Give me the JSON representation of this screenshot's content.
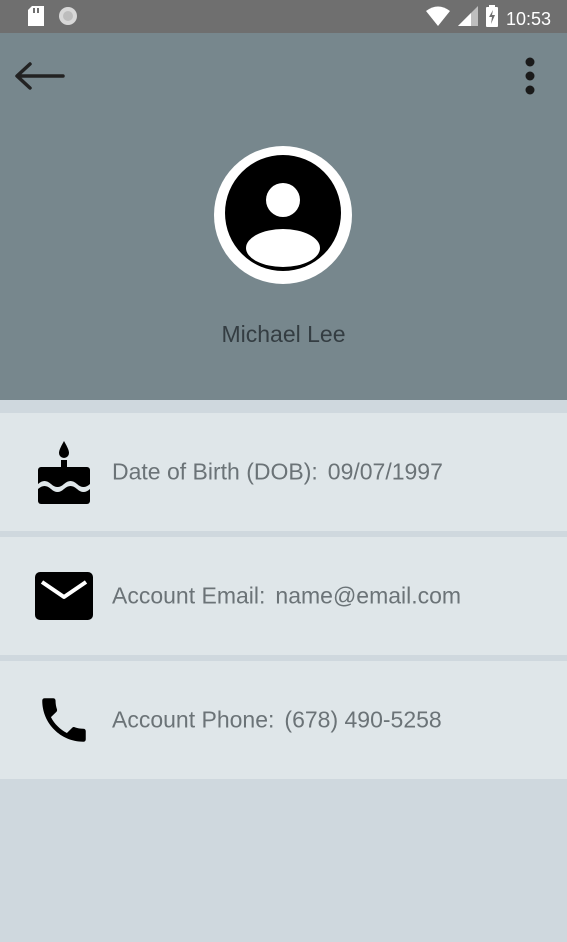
{
  "status_bar": {
    "time": "10:53",
    "icons": [
      "sd-card-icon",
      "circle-indicator-icon",
      "wifi-icon",
      "signal-icon",
      "battery-charging-icon"
    ]
  },
  "toolbar": {
    "back_icon": "arrow-left-icon",
    "menu_icon": "more-vertical-icon"
  },
  "profile": {
    "name": "Michael Lee",
    "avatar_icon": "account-circle-icon"
  },
  "details": [
    {
      "icon": "cake-icon",
      "label": "Date of Birth (DOB):",
      "value": "09/07/1997"
    },
    {
      "icon": "email-icon",
      "label": "Account Email:",
      "value": "name@email.com"
    },
    {
      "icon": "phone-icon",
      "label": "Account Phone:",
      "value": "(678) 490-5258"
    }
  ],
  "colors": {
    "status_bar": "#6f6f6f",
    "header": "#77878d",
    "row_background": "#dfe6e9",
    "page_background": "#cfd8de",
    "text": "#6b7377"
  }
}
